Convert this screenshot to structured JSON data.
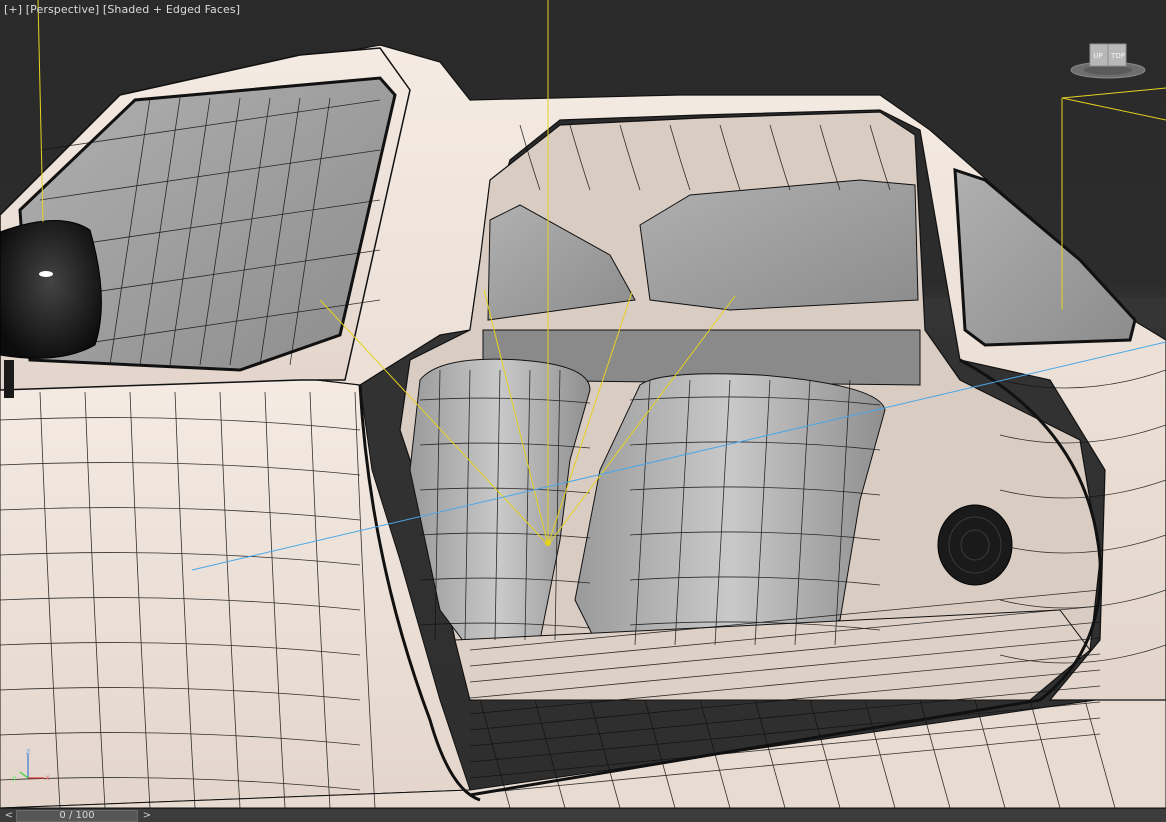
{
  "viewport": {
    "label_plus": "[+]",
    "label_view": "[Perspective]",
    "label_shading": "[Shaded + Edged Faces]"
  },
  "viewcube": {
    "face_left": "UP",
    "face_right": "TOP"
  },
  "axis": {
    "x": "x",
    "y": "y",
    "z": "z"
  },
  "timeline": {
    "prev": "<",
    "frame": "0 / 100",
    "next": ">"
  },
  "colors": {
    "body_paint": "#eee2d8",
    "wire": "#111111",
    "glass": "#9e9e9e",
    "seat": "#b9b9b9",
    "light_target": "#e6d21e",
    "camera_line": "#4aa6e8"
  },
  "icons": [
    "viewcube-icon",
    "axis-tripod-icon",
    "light-icon",
    "speaker-icon"
  ]
}
